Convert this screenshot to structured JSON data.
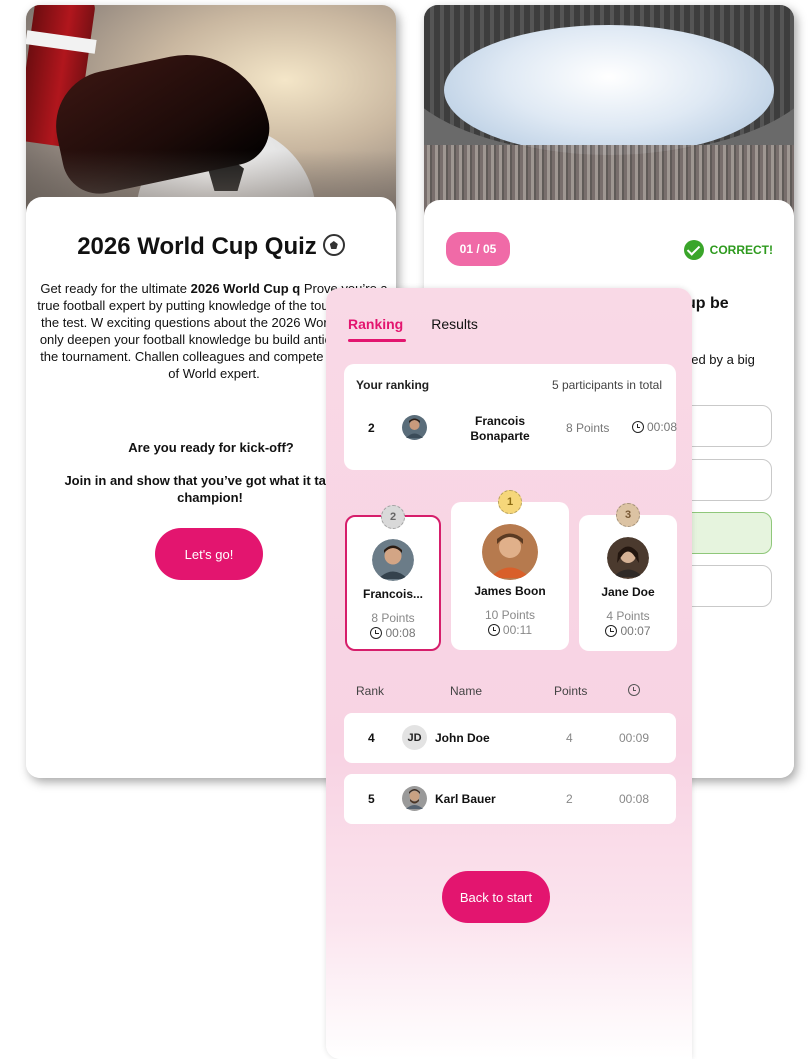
{
  "intro": {
    "title": "2026 World Cup Quiz",
    "icon": "soccer-ball-icon",
    "desc_p1": "Get ready for the ultimate ",
    "desc_bold": "2026 World Cup q",
    "desc_p2": " Prove you’re a true football expert by putting knowledge of the tournament to the test. W exciting questions about the 2026 World Cup not only deepen your football knowledge bu build anticipation for the tournament. Challen colleagues and compete for the title of World expert.",
    "question1": "Are you ready for kick-off?",
    "question2": "Join in and show that you’ve got what it ta be a champion!",
    "start_button": "Let's go!"
  },
  "question": {
    "counter": "01 / 05",
    "status": "CORRECT!",
    "text": "up be",
    "subtext": "ded by a big",
    "status_color": "#2e9a1e"
  },
  "ranking": {
    "tabs": [
      "Ranking",
      "Results"
    ],
    "your_ranking_label": "Your ranking",
    "participants_total": "5 participants in total",
    "me": {
      "rank": "2",
      "name": "Francois Bonaparte",
      "points": "8 Points",
      "time": "00:08"
    },
    "podium": [
      {
        "place": "2",
        "name": "Francois...",
        "points": "8 Points",
        "time": "00:08"
      },
      {
        "place": "1",
        "name": "James Boon",
        "points": "10 Points",
        "time": "00:11"
      },
      {
        "place": "3",
        "name": "Jane Doe",
        "points": "4 Points",
        "time": "00:07"
      }
    ],
    "columns": {
      "rank": "Rank",
      "name": "Name",
      "points": "Points",
      "time_icon": "clock-icon"
    },
    "rows": [
      {
        "rank": "4",
        "initials": "JD",
        "name": "John Doe",
        "points": "4",
        "time": "00:09"
      },
      {
        "rank": "5",
        "initials": "",
        "name": "Karl Bauer",
        "points": "2",
        "time": "00:08"
      }
    ],
    "back_button": "Back to start",
    "accent": "#e3156f",
    "gold": "#f6d77a",
    "silver": "#d9d9d9",
    "bronze": "#dcc3a3"
  }
}
